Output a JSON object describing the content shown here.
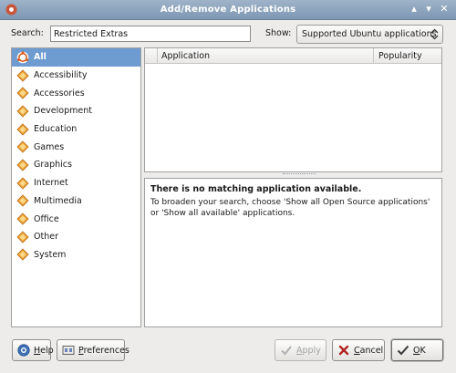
{
  "window": {
    "title": "Add/Remove Applications"
  },
  "search": {
    "label": "Search:",
    "value": "Restricted Extras"
  },
  "show": {
    "label": "Show:",
    "selected": "Supported Ubuntu applications"
  },
  "categories": [
    {
      "label": "All",
      "icon": "ubuntu-logo-icon",
      "selected": true
    },
    {
      "label": "Accessibility",
      "icon": "category-diamond-icon"
    },
    {
      "label": "Accessories",
      "icon": "category-diamond-icon"
    },
    {
      "label": "Development",
      "icon": "category-diamond-icon"
    },
    {
      "label": "Education",
      "icon": "category-diamond-icon"
    },
    {
      "label": "Games",
      "icon": "category-diamond-icon"
    },
    {
      "label": "Graphics",
      "icon": "category-diamond-icon"
    },
    {
      "label": "Internet",
      "icon": "category-diamond-icon"
    },
    {
      "label": "Multimedia",
      "icon": "category-diamond-icon"
    },
    {
      "label": "Office",
      "icon": "category-diamond-icon"
    },
    {
      "label": "Other",
      "icon": "category-diamond-icon"
    },
    {
      "label": "System",
      "icon": "category-diamond-icon"
    }
  ],
  "apps_table": {
    "col_application": "Application",
    "col_popularity": "Popularity"
  },
  "description": {
    "title": "There is no matching application available.",
    "body": "To broaden your search, choose 'Show all Open Source applications' or 'Show all available' applications."
  },
  "buttons": {
    "help": {
      "mnemonic": "H",
      "rest": "elp"
    },
    "preferences": {
      "mnemonic": "P",
      "rest": "references"
    },
    "apply": {
      "mnemonic": "A",
      "rest": "pply"
    },
    "cancel": {
      "mnemonic": "C",
      "rest": "ancel"
    },
    "ok": {
      "mnemonic": "O",
      "rest": "K"
    }
  },
  "colors": {
    "selection": "#6e9bd0",
    "titlebar": "#8ca3bd",
    "category_icon": "#e8a030"
  }
}
